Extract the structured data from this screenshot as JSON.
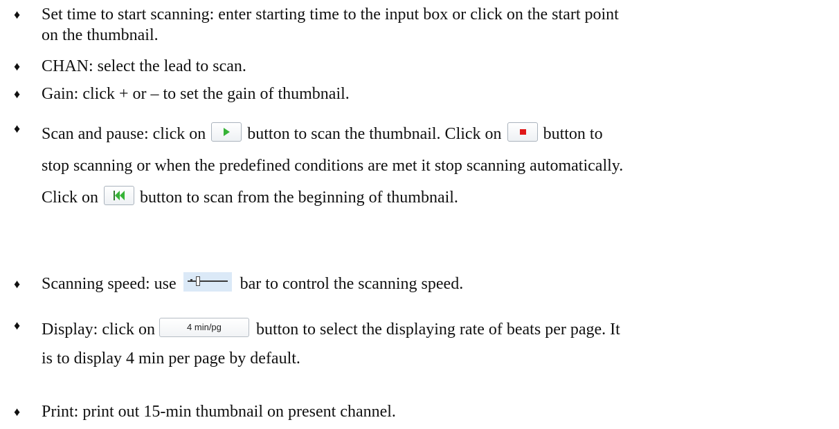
{
  "bullet_symbol": "♦",
  "items": [
    {
      "line1": "Set time to start scanning: enter starting time to the input box or click on the start point",
      "line2": "on the thumbnail."
    },
    {
      "text": "CHAN: select the lead to scan."
    },
    {
      "text": "Gain: click + or – to set the gain of thumbnail."
    },
    {
      "part1": "Scan and pause: click on",
      "part2": "button to scan the thumbnail. Click on",
      "part3": "button to",
      "line2": "stop scanning or when the predefined conditions are met it stop scanning automatically.",
      "line3_part1": "Click on",
      "line3_part2": "button to scan from the beginning of thumbnail."
    },
    {
      "part1": "Scanning speed: use",
      "part2": "bar to control the scanning speed."
    },
    {
      "part1": "Display: click on",
      "button_label": "4 min/pg",
      "part2": "button to select the displaying rate of beats per page. It",
      "line2": "is to display 4 min per page by default."
    },
    {
      "text": "Print: print out 15-min thumbnail on present channel."
    }
  ],
  "icons": {
    "play": "play-icon",
    "stop": "stop-icon",
    "rewind": "rewind-icon",
    "slider": "speed-slider-icon"
  },
  "colors": {
    "play_green": "#36b336",
    "stop_red": "#e01818",
    "slider_bg": "#dbe9f7"
  }
}
